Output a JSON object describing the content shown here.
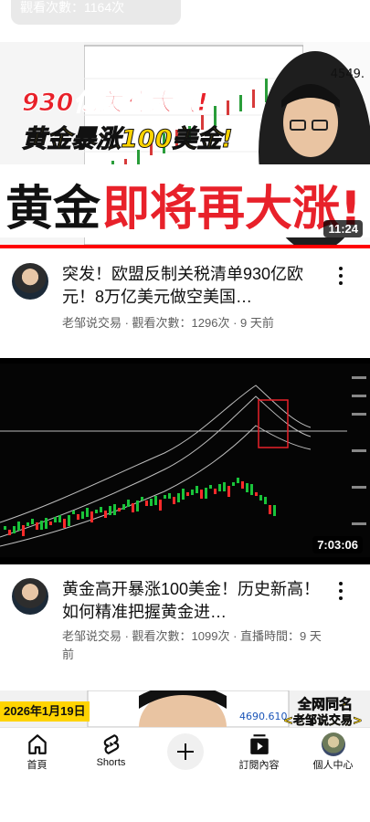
{
  "top_chip": {
    "text": "觀看次數：1164次"
  },
  "videos": [
    {
      "thumb": {
        "line1": "930亿关税大战!",
        "line2": "黄金暴涨100美金!",
        "line3a": "黄金",
        "line3b": "即将再大涨!",
        "chart_label": "4549.",
        "duration": "11:24",
        "progress": 1.0
      },
      "title": "突发！欧盟反制关税清单930亿欧元！8万亿美元做空美国…",
      "channel_line": "老邹说交易 · 觀看次數：1296次 · 9 天前"
    },
    {
      "thumb": {
        "duration": "7:03:06"
      },
      "title": "黄金高开暴涨100美金！历史新高！如何精准把握黄金进…",
      "channel_line": "老邹说交易 · 觀看次數：1099次 · 直播時間：9 天前"
    },
    {
      "thumb": {
        "date": "2026年1月19日",
        "price": "4690.610",
        "tag1": "全网同名",
        "tag2": "<老邹说交易>"
      }
    }
  ],
  "nav": [
    {
      "label": "首頁",
      "icon": "home-icon"
    },
    {
      "label": "Shorts",
      "icon": "shorts-icon"
    },
    {
      "label": "",
      "icon": "create-icon"
    },
    {
      "label": "訂閱內容",
      "icon": "subscriptions-icon"
    },
    {
      "label": "個人中心",
      "icon": "profile-avatar-icon"
    }
  ],
  "colors": {
    "accent": "#ff0000",
    "text_secondary": "#606060",
    "thumb_red": "#e8212a",
    "thumb_yellow": "#ffd400"
  }
}
